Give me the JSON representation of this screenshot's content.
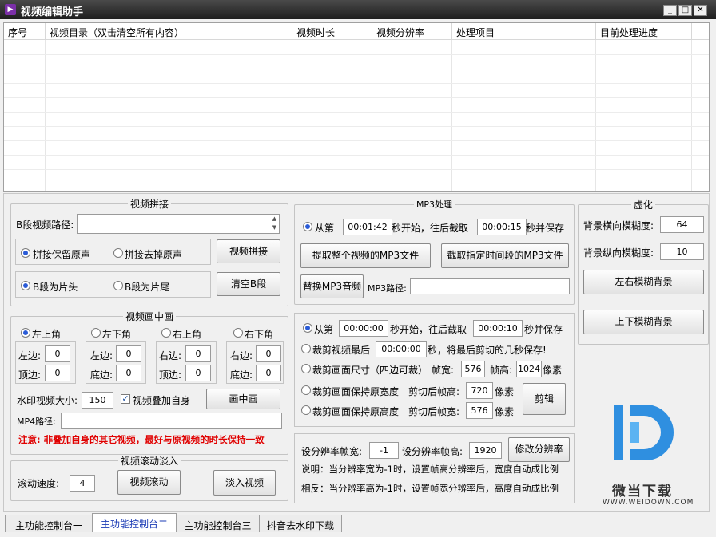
{
  "window": {
    "title": "视频编辑助手"
  },
  "table": {
    "headers": [
      "序号",
      "视频目录（双击清空所有内容）",
      "视频时长",
      "视频分辨率",
      "处理项目",
      "目前处理进度"
    ]
  },
  "concat": {
    "title": "视频拼接",
    "b_path_label": "B段视频路径:",
    "b_path_value": "",
    "radio_keep_audio": "拼接保留原声",
    "radio_remove_audio": "拼接去掉原声",
    "concat_button": "视频拼接",
    "radio_b_head": "B段为片头",
    "radio_b_tail": "B段为片尾",
    "clear_b_button": "清空B段"
  },
  "pip": {
    "title": "视频画中画",
    "positions": [
      "左上角",
      "左下角",
      "右上角",
      "右下角"
    ],
    "boxes": [
      {
        "l1": "左边:",
        "v1": "0",
        "l2": "顶边:",
        "v2": "0"
      },
      {
        "l1": "左边:",
        "v1": "0",
        "l2": "底边:",
        "v2": "0"
      },
      {
        "l1": "右边:",
        "v1": "0",
        "l2": "顶边:",
        "v2": "0"
      },
      {
        "l1": "右边:",
        "v1": "0",
        "l2": "底边:",
        "v2": "0"
      }
    ],
    "watermark_size_label": "水印视频大小:",
    "watermark_size_value": "150",
    "overlay_self_label": "视频叠加自身",
    "overlay_self_checked": true,
    "pip_button": "画中画",
    "mp4_path_label": "MP4路径:",
    "mp4_path_value": "",
    "note": "注意: 非叠加自身的其它视频，最好与原视频的时长保持一致"
  },
  "scroll": {
    "title": "视频滚动淡入",
    "speed_label": "滚动速度:",
    "speed_value": "4",
    "scroll_button": "视频滚动",
    "fade_button": "淡入视频"
  },
  "mp3": {
    "title": "MP3处理",
    "from_label": "从第",
    "start_time": "00:01:42",
    "mid_label": "秒开始，往后截取",
    "duration": "00:00:15",
    "end_label": "秒并保存",
    "extract_all_button": "提取整个视频的MP3文件",
    "extract_range_button": "截取指定时间段的MP3文件",
    "replace_button": "替换MP3音频",
    "path_label": "MP3路径:",
    "path_value": ""
  },
  "cut": {
    "r1_from": "从第",
    "r1_start": "00:00:00",
    "r1_mid": "秒开始，往后截取",
    "r1_dur": "00:00:10",
    "r1_end": "秒并保存",
    "r2_label": "裁剪视频最后",
    "r2_value": "00:00:00",
    "r2_end": "秒，将最后剪切的几秒保存!",
    "r3_label": "裁剪画面尺寸（四边可裁）",
    "r3_w_label": "帧宽:",
    "r3_w": "576",
    "r3_h_label": "帧高:",
    "r3_h": "1024",
    "r3_unit": "像素",
    "r4_label": "裁剪画面保持原宽度",
    "r4_sub": "剪切后帧高:",
    "r4_value": "720",
    "r4_unit": "像素",
    "r5_label": "裁剪画面保持原高度",
    "r5_sub": "剪切后帧宽:",
    "r5_value": "576",
    "r5_unit": "像素",
    "cut_button": "剪辑"
  },
  "resolution": {
    "w_label": "设分辨率帧宽:",
    "w_value": "-1",
    "h_label": "设分辨率帧高:",
    "h_value": "1920",
    "button": "修改分辨率",
    "note1": "说明：当分辨率宽为-1时，设置帧高分辨率后，宽度自动成比例",
    "note2": "相反：当分辨率高为-1时，设置帧宽分辨率后，高度自动成比例"
  },
  "blur": {
    "title": "虚化",
    "h_label": "背景横向模糊度:",
    "h_value": "64",
    "v_label": "背景纵向模糊度:",
    "v_value": "10",
    "lr_button": "左右模糊背景",
    "ud_button": "上下模糊背景"
  },
  "tabs": [
    "主功能控制台一",
    "主功能控制台二",
    "主功能控制台三",
    "抖音去水印下载"
  ],
  "active_tab": 1,
  "watermark_logo": {
    "text": "微当下载",
    "url": "WWW.WEIDOWN.COM"
  }
}
